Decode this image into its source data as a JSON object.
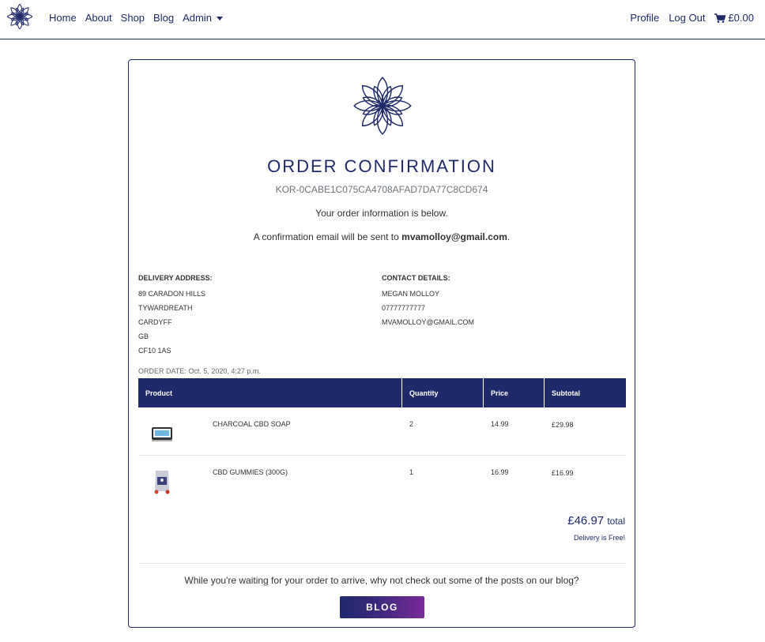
{
  "nav": {
    "logo_icon": "lotus-logo-icon",
    "links": [
      "Home",
      "About",
      "Shop",
      "Blog"
    ],
    "admin_label": "Admin",
    "profile_label": "Profile",
    "logout_label": "Log Out",
    "cart_total": "£0.00",
    "cart_icon": "cart-icon"
  },
  "card": {
    "logo_icon": "lotus-logo-icon",
    "title": "ORDER CONFIRMATION",
    "order_number": "KOR-0CABE1C075CA4708AFAD7DA77C8CD674",
    "info_line": "Your order information is below.",
    "email_prefix": "A confirmation email will be sent to ",
    "email": "mvamolloy@gmail.com",
    "email_suffix": "."
  },
  "delivery": {
    "heading": "DELIVERY ADDRESS:",
    "lines": [
      "89 CARADON HILLS",
      "TYWARDREATH",
      "CARDYFF",
      "GB",
      "CF10 1AS"
    ]
  },
  "contact": {
    "heading": "CONTACT DETAILS:",
    "lines": [
      "MEGAN MOLLOY",
      "07777777777",
      "MVAMOLLOY@GMAIL.COM"
    ]
  },
  "order_date": "ORDER DATE: Oct. 5, 2020, 4:27 p.m.",
  "table": {
    "headers": [
      "Product",
      "Quantity",
      "Price",
      "Subtotal"
    ],
    "rows": [
      {
        "name": "CHARCOAL CBD SOAP",
        "quantity": "2",
        "price": "14.99",
        "subtotal": "£29.98"
      },
      {
        "name": "CBD GUMMIES (300G)",
        "quantity": "1",
        "price": "16.99",
        "subtotal": "£16.99"
      }
    ]
  },
  "summary": {
    "total_amount": "£46.97",
    "total_word": "total",
    "delivery_note": "Delivery is Free!"
  },
  "blog": {
    "prompt": "While you're waiting for your order to arrive, why not check out some of the posts on our blog?",
    "button_label": "BLOG"
  },
  "colors": {
    "brand": "#1f2a6b",
    "button_gradient_end": "#7a2a9a"
  }
}
